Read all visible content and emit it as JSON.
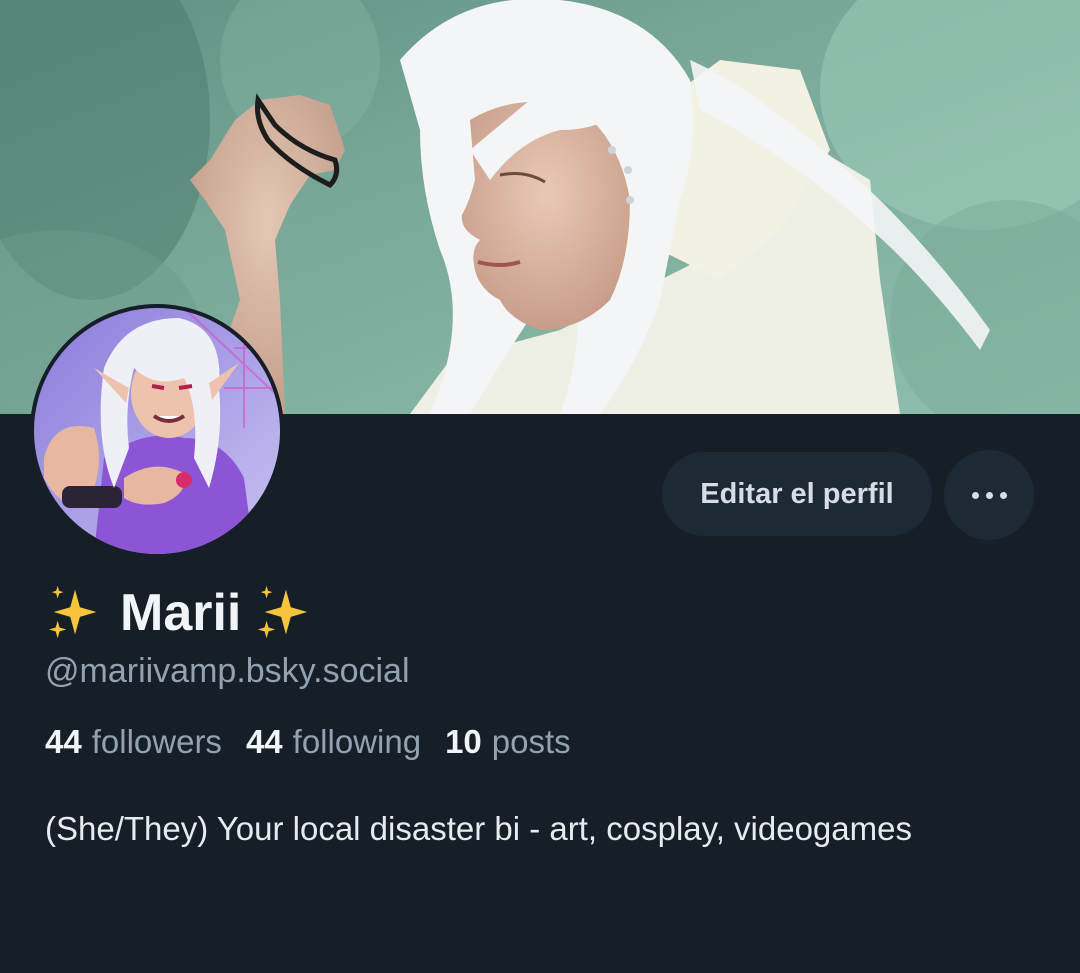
{
  "profile": {
    "display_name": "Marii",
    "handle": "@mariivamp.bsky.social",
    "bio": "(She/They) Your local disaster bi - art, cosplay, videogames",
    "stats": {
      "followers_count": "44",
      "followers_label": "followers",
      "following_count": "44",
      "following_label": "following",
      "posts_count": "10",
      "posts_label": "posts"
    }
  },
  "actions": {
    "edit_profile_label": "Editar el perfil",
    "more_icon": "ellipsis-icon"
  },
  "icons": {
    "name_prefix": "sparkles-icon",
    "name_suffix": "sparkles-icon"
  },
  "colors": {
    "background": "#161e27",
    "button_bg": "#1e2936",
    "primary_text": "#f1f4f8",
    "secondary_text": "#93a1b2",
    "sparkle": "#f6c53b"
  }
}
